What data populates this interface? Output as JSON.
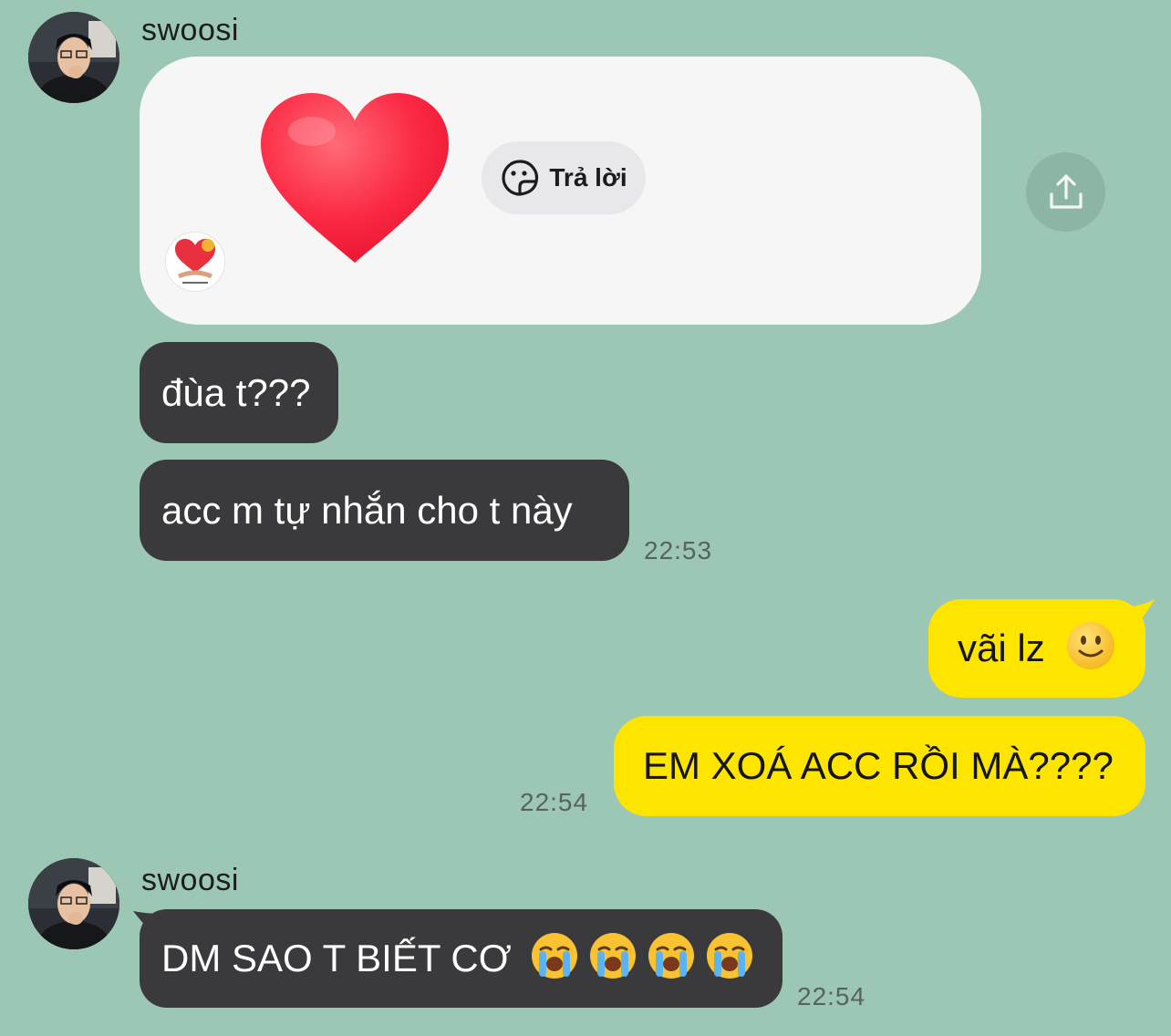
{
  "chat": {
    "sender_name": "swoosi",
    "sticker": {
      "reply_label": "Trả lời"
    },
    "messages": {
      "m1": "đùa t???",
      "m2": "acc m tự nhắn cho t này",
      "m2_time": "22:53",
      "m3": "vãi lz",
      "m4": "EM XOÁ ACC RỒI MÀ????",
      "m4_time": "22:54",
      "m5": "DM SAO T BIẾT CƠ",
      "m5_time": "22:54"
    }
  },
  "icons": {
    "share": "share-upload-icon",
    "reply": "face-reply-icon",
    "heart": "heart-sticker",
    "smile": "slightly-smiling-face-emoji",
    "cry": "loudly-crying-face-emoji"
  },
  "colors": {
    "background": "#9dc7b5",
    "incoming_bubble": "#3a3a3c",
    "outgoing_bubble": "#fee500",
    "sticker_card": "#f6f6f6"
  }
}
